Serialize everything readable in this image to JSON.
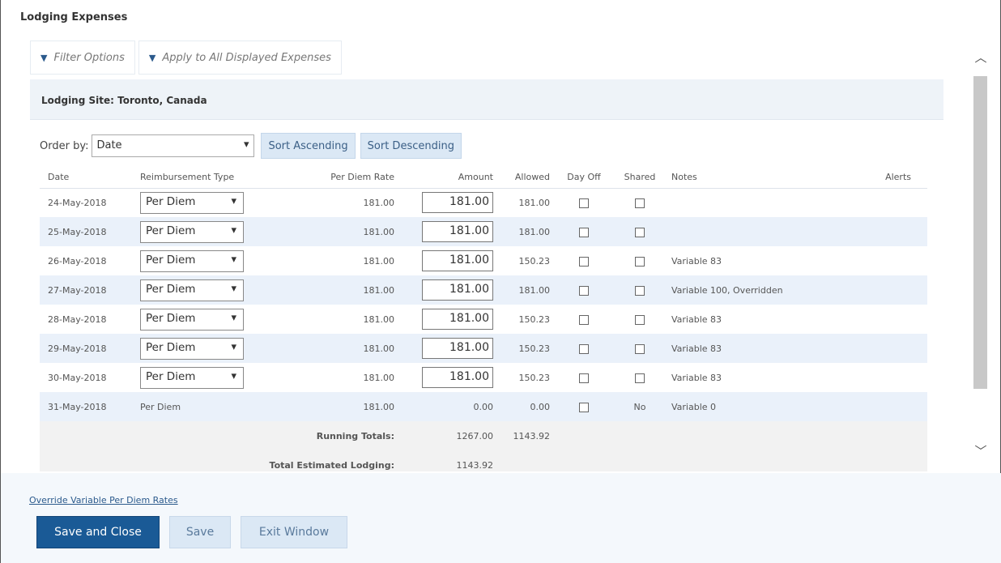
{
  "page": {
    "title": "Lodging Expenses"
  },
  "toolbar": {
    "filter_label": "Filter Options",
    "apply_label": "Apply to All Displayed Expenses"
  },
  "site": {
    "header": "Lodging Site: Toronto, Canada"
  },
  "order": {
    "label": "Order by:",
    "selected": "Date",
    "sort_asc": "Sort Ascending",
    "sort_desc": "Sort Descending"
  },
  "table": {
    "headers": {
      "date": "Date",
      "type": "Reimbursement Type",
      "rate": "Per Diem Rate",
      "amount": "Amount",
      "allowed": "Allowed",
      "dayoff": "Day Off",
      "shared": "Shared",
      "notes": "Notes",
      "alerts": "Alerts"
    },
    "rows": [
      {
        "date": "24-May-2018",
        "type": "Per Diem",
        "rate": "181.00",
        "amount": "181.00",
        "allowed": "181.00",
        "notes": ""
      },
      {
        "date": "25-May-2018",
        "type": "Per Diem",
        "rate": "181.00",
        "amount": "181.00",
        "allowed": "181.00",
        "notes": ""
      },
      {
        "date": "26-May-2018",
        "type": "Per Diem",
        "rate": "181.00",
        "amount": "181.00",
        "allowed": "150.23",
        "notes": "Variable 83"
      },
      {
        "date": "27-May-2018",
        "type": "Per Diem",
        "rate": "181.00",
        "amount": "181.00",
        "allowed": "181.00",
        "notes": "Variable 100, Overridden"
      },
      {
        "date": "28-May-2018",
        "type": "Per Diem",
        "rate": "181.00",
        "amount": "181.00",
        "allowed": "150.23",
        "notes": "Variable 83"
      },
      {
        "date": "29-May-2018",
        "type": "Per Diem",
        "rate": "181.00",
        "amount": "181.00",
        "allowed": "150.23",
        "notes": "Variable 83"
      },
      {
        "date": "30-May-2018",
        "type": "Per Diem",
        "rate": "181.00",
        "amount": "181.00",
        "allowed": "150.23",
        "notes": "Variable 83"
      }
    ],
    "last_row": {
      "date": "31-May-2018",
      "type": "Per Diem",
      "rate": "181.00",
      "amount": "0.00",
      "allowed": "0.00",
      "shared": "No",
      "notes": "Variable 0"
    },
    "totals": {
      "running_label": "Running Totals:",
      "running_amount": "1267.00",
      "running_allowed": "1143.92",
      "estimated_label": "Total Estimated Lodging:",
      "estimated_amount": "1143.92"
    }
  },
  "footer": {
    "override_link": "Override Variable Per Diem Rates",
    "save_close": "Save and Close",
    "save": "Save",
    "exit": "Exit Window"
  },
  "colors": {
    "primary": "#1a5a96",
    "row_alt": "#eaf1fa",
    "button_secondary": "#dbe8f5"
  }
}
